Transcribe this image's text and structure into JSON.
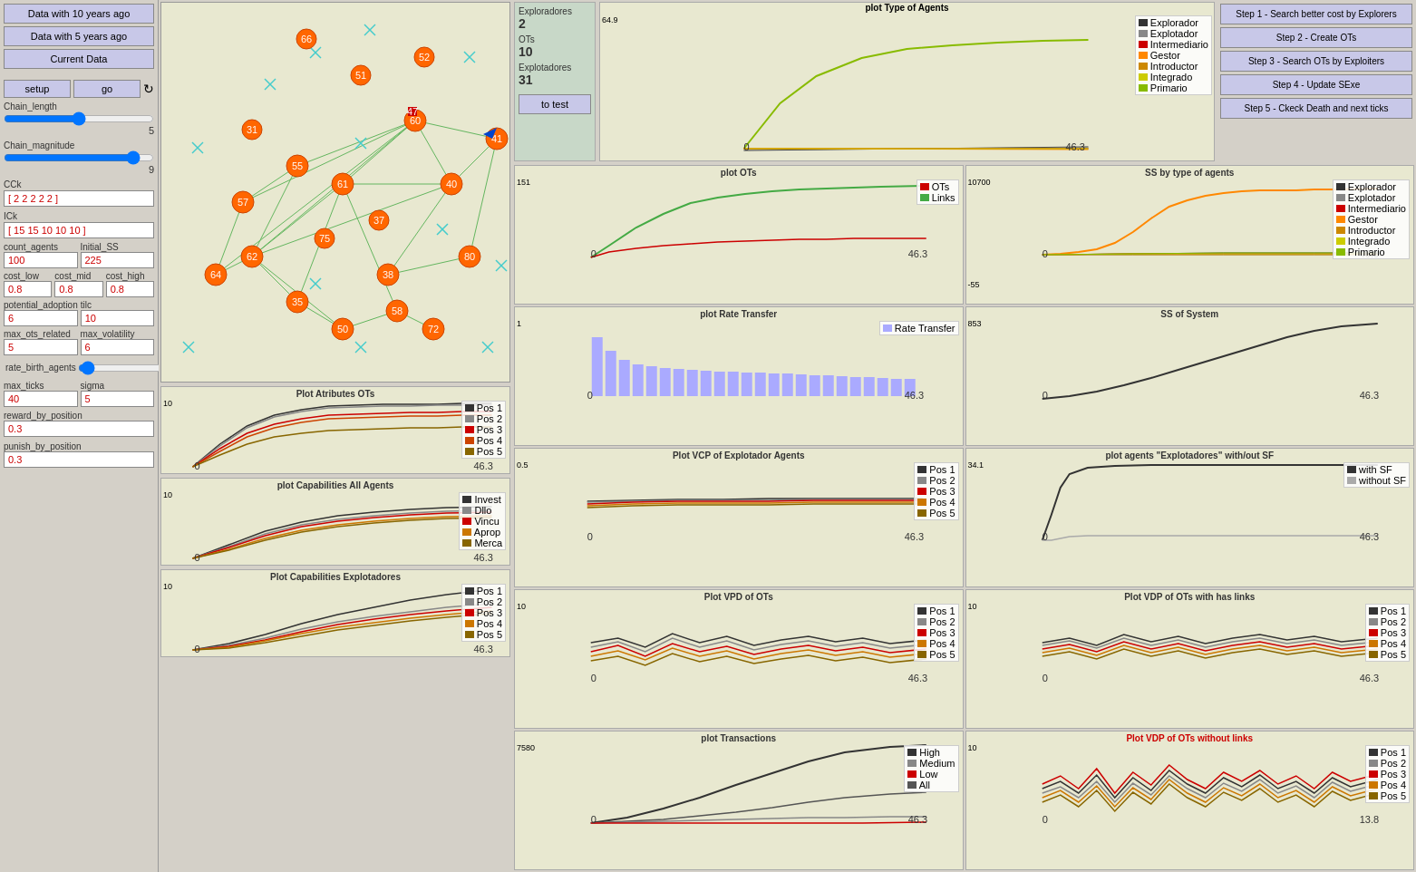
{
  "left": {
    "btn_10years": "Data with 10 years ago",
    "btn_5years": "Data with 5 years ago",
    "btn_current": "Current Data",
    "btn_setup": "setup",
    "btn_go": "go",
    "chain_length_label": "Chain_length",
    "chain_length_val": "5",
    "chain_magnitude_label": "Chain_magnitude",
    "chain_magnitude_val": "9",
    "cck_label": "CCk",
    "cck_val": "[ 2 2 2 2 2 ]",
    "ick_label": "ICk",
    "ick_val": "[ 15 15 10 10 10 ]",
    "count_agents_label": "count_agents",
    "count_agents_val": "100",
    "initial_ss_label": "Initial_SS",
    "initial_ss_val": "225",
    "cost_low_label": "cost_low",
    "cost_low_val": "0.8",
    "cost_mid_label": "cost_mid",
    "cost_mid_val": "0.8",
    "cost_high_label": "cost_high",
    "cost_high_val": "0.8",
    "potential_adoption_label": "potential_adoption",
    "potential_adoption_val": "6",
    "tilc_label": "tilc",
    "tilc_val": "10",
    "max_ots_related_label": "max_ots_related",
    "max_ots_related_val": "5",
    "max_volatility_label": "max_volatility",
    "max_volatility_val": "6",
    "rate_birth_agents_label": "rate_birth_agents",
    "rate_birth_agents_val": "3 %",
    "max_ticks_label": "max_ticks",
    "max_ticks_val": "40",
    "sigma_label": "sigma",
    "sigma_val": "5",
    "reward_by_position_label": "reward_by_position",
    "reward_by_position_val": "0.3",
    "punish_by_position_label": "punish_by_position",
    "punish_by_position_val": "0.3"
  },
  "stats": {
    "exploradores_label": "Exploradores",
    "exploradores_val": "2",
    "ots_label": "OTs",
    "ots_val": "10",
    "explotadores_label": "Explotadores",
    "explotadores_val": "31",
    "test_btn": "to test"
  },
  "steps": {
    "step1": "Step 1 - Search better cost by Explorers",
    "step2": "Step 2 - Create OTs",
    "step3": "Step 3 - Search OTs by Exploiters",
    "step4": "Step 4 - Update SExe",
    "step5": "Step 5 - Ckeck Death and next ticks"
  },
  "plots": {
    "type_agents_title": "plot Type of Agents",
    "type_agents_ymax": "64.9",
    "type_agents_xmax": "46.3",
    "ots_title": "plot OTs",
    "ots_ymax": "151",
    "ots_xmax": "46.3",
    "rate_transfer_title": "plot Rate Transfer",
    "rate_transfer_ymax": "1",
    "rate_transfer_xmax": "46.3",
    "vcp_explotador_title": "Plot VCP of Explotador Agents",
    "vcp_explotador_ymax": "0.5",
    "vcp_explotador_xmax": "46.3",
    "vpd_ots_title": "Plot VPD of OTs",
    "vpd_ots_ymax": "10",
    "vpd_ots_xmax": "46.3",
    "transactions_title": "plot Transactions",
    "transactions_ymax": "7580",
    "transactions_xmax": "46.3",
    "ss_type_agents_title": "SS by type of agents",
    "ss_type_agents_ymax": "10700",
    "ss_type_agents_ymin": "-55",
    "ss_type_agents_xmax": "46.3",
    "ss_system_title": "SS of System",
    "ss_system_ymax": "853",
    "ss_system_xmax": "46.3",
    "agents_sf_title": "plot agents \"Explotadores\" with/out SF",
    "agents_sf_ymax": "34.1",
    "agents_sf_xmax": "46.3",
    "vpd_ots_links_title": "Plot VDP of OTs with has links",
    "vpd_ots_links_ymax": "10",
    "vpd_ots_links_xmax": "46.3",
    "vpd_ots_nolinks_title": "Plot VDP of OTs without links",
    "vpd_ots_nolinks_ymax": "10",
    "vpd_ots_nolinks_xmax": "13.8",
    "attr_ots_title": "Plot Atributes OTs",
    "attr_ots_ymax": "10",
    "attr_ots_xmax": "46.3",
    "cap_all_title": "plot Capabilities All Agents",
    "cap_all_ymax": "10",
    "cap_all_xmax": "46.3",
    "cap_explota_title": "Plot Capabilities Explotadores",
    "cap_explota_ymax": "10",
    "cap_explota_xmax": "46.3"
  },
  "legend": {
    "type_agents": [
      "Explorador",
      "Explotador",
      "Intermediario",
      "Gestor",
      "Introductor",
      "Integrado",
      "Primario"
    ],
    "ots": [
      "OTs",
      "Links"
    ],
    "rate_transfer": [
      "Rate Transfer"
    ],
    "pos5": [
      "Pos 1",
      "Pos 2",
      "Pos 3",
      "Pos 4",
      "Pos 5"
    ],
    "ss_type": [
      "Explorador",
      "Explotador",
      "Intermediario",
      "Gestor",
      "Introductor",
      "Integrado",
      "Primario"
    ],
    "invest": [
      "Invest",
      "Dllo",
      "Vincu",
      "Aprop",
      "Merca"
    ],
    "sf": [
      "with SF",
      "without SF"
    ],
    "transactions": [
      "High",
      "Medium",
      "Low",
      "All"
    ]
  }
}
